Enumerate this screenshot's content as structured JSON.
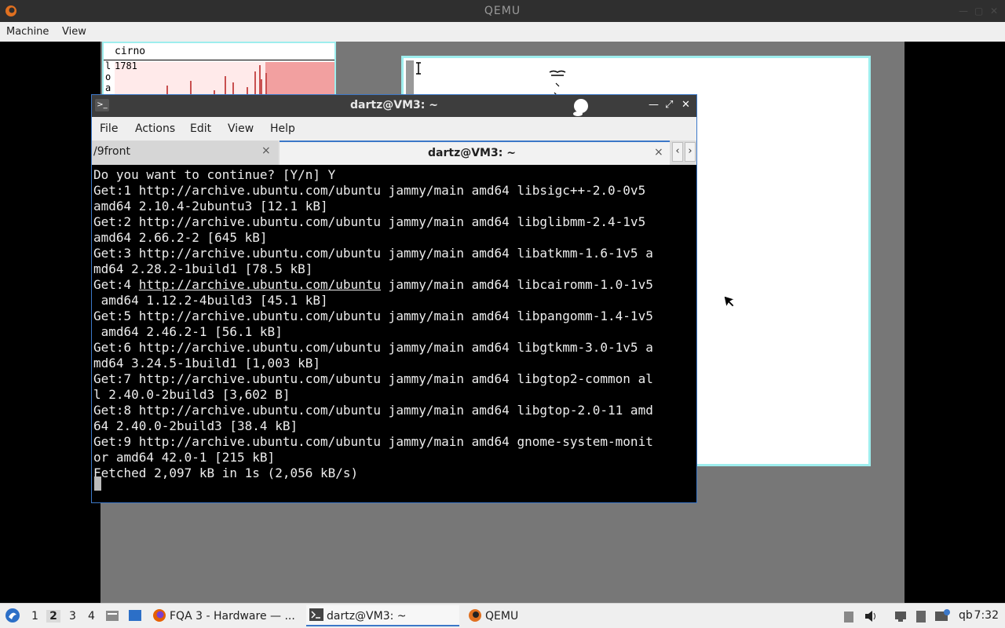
{
  "qemu": {
    "title": "QEMU",
    "menu": [
      "Machine",
      "View"
    ]
  },
  "stats_window": {
    "name": "cirno",
    "labels": [
      "l",
      "o",
      "a"
    ],
    "value": "1781",
    "graph_level_pct": 100
  },
  "terminal": {
    "title": "dartz@VM3: ~",
    "menu": [
      "File",
      "Actions",
      "Edit",
      "View",
      "Help"
    ],
    "tabs": [
      {
        "label": "/9front",
        "close": "×"
      },
      {
        "label": "dartz@VM3: ~",
        "close": "×"
      }
    ],
    "lines": [
      "Do you want to continue? [Y/n] Y",
      "Get:1 http://archive.ubuntu.com/ubuntu jammy/main amd64 libsigc++-2.0-0v5",
      "amd64 2.10.4-2ubuntu3 [12.1 kB]",
      "Get:2 http://archive.ubuntu.com/ubuntu jammy/main amd64 libglibmm-2.4-1v5",
      "amd64 2.66.2-2 [645 kB]",
      "Get:3 http://archive.ubuntu.com/ubuntu jammy/main amd64 libatkmm-1.6-1v5 a",
      "md64 2.28.2-1build1 [78.5 kB]",
      "Get:4 ",
      " amd64 1.12.2-4build3 [45.1 kB]",
      "Get:5 http://archive.ubuntu.com/ubuntu jammy/main amd64 libpangomm-1.4-1v5",
      " amd64 2.46.2-1 [56.1 kB]",
      "Get:6 http://archive.ubuntu.com/ubuntu jammy/main amd64 libgtkmm-3.0-1v5 a",
      "md64 3.24.5-1build1 [1,003 kB]",
      "Get:7 http://archive.ubuntu.com/ubuntu jammy/main amd64 libgtop2-common al",
      "l 2.40.0-2build3 [3,602 B]",
      "Get:8 http://archive.ubuntu.com/ubuntu jammy/main amd64 libgtop-2.0-11 amd",
      "64 2.40.0-2build3 [38.4 kB]",
      "Get:9 http://archive.ubuntu.com/ubuntu jammy/main amd64 gnome-system-monit",
      "or amd64 42.0-1 [215 kB]",
      "Fetched 2,097 kB in 1s (2,056 kB/s)"
    ],
    "link_line": {
      "prefix": "Get:4 ",
      "link": "http://archive.ubuntu.com/ubuntu",
      "suffix": " jammy/main amd64 libcairomm-1.0-1v5"
    }
  },
  "taskbar": {
    "workspaces": [
      "1",
      "2",
      "3",
      "4"
    ],
    "current_workspace": "2",
    "tasks": [
      {
        "label": "FQA 3 - Hardware — ...",
        "icon": "firefox-icon"
      },
      {
        "label": "dartz@VM3: ~",
        "icon": "terminal-icon"
      },
      {
        "label": "QEMU",
        "icon": "qemu-icon"
      }
    ],
    "tray_text": "qb",
    "clock": "7:32"
  },
  "colors": {
    "accent": "#3c78c8",
    "rio_border": "#9eeeee",
    "guest_bg": "#777777"
  }
}
